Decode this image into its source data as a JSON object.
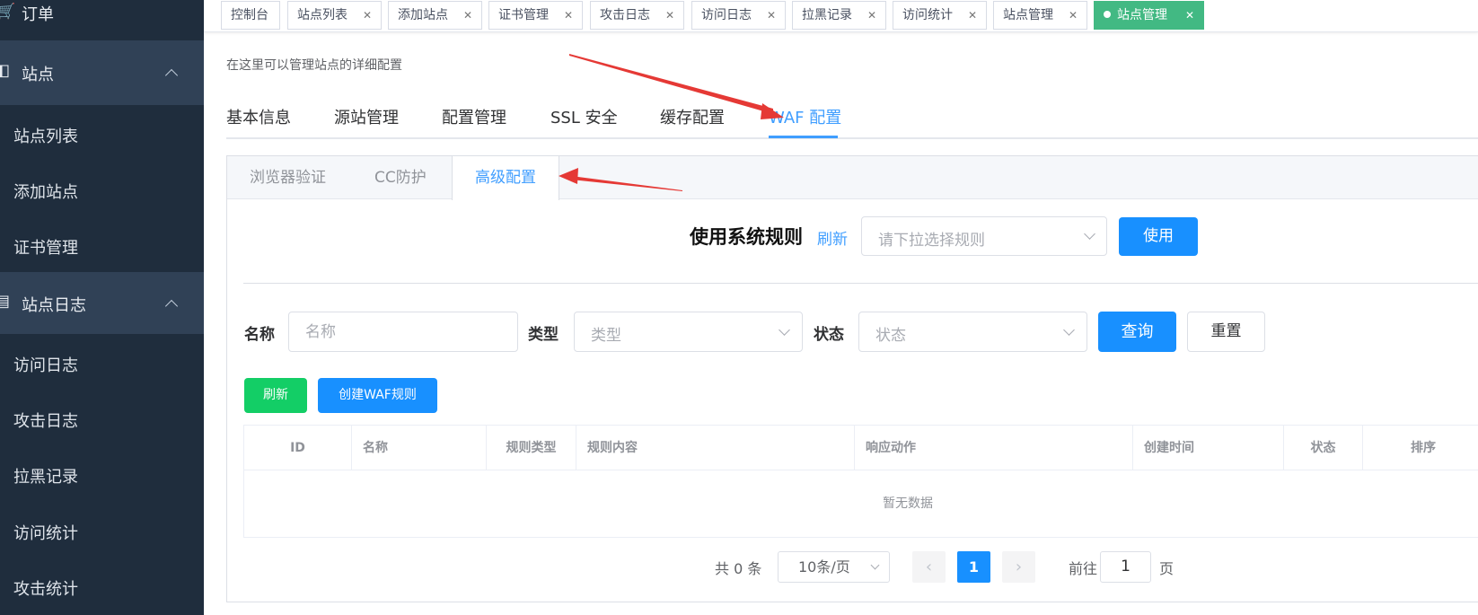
{
  "sidebar": {
    "order_label": "订单",
    "groups": [
      {
        "label": "站点",
        "icon": "site-icon"
      },
      {
        "label": "站点日志",
        "icon": "log-icon"
      }
    ],
    "site_items": [
      "站点列表",
      "添加站点",
      "证书管理"
    ],
    "log_items": [
      "访问日志",
      "攻击日志",
      "拉黑记录",
      "访问统计",
      "攻击统计"
    ]
  },
  "tags": [
    {
      "label": "控制台"
    },
    {
      "label": "站点列表"
    },
    {
      "label": "添加站点"
    },
    {
      "label": "证书管理"
    },
    {
      "label": "攻击日志"
    },
    {
      "label": "访问日志"
    },
    {
      "label": "拉黑记录"
    },
    {
      "label": "访问统计"
    },
    {
      "label": "站点管理"
    },
    {
      "label": "站点管理",
      "active": true
    }
  ],
  "description": "在这里可以管理站点的详细配置",
  "main_tabs": [
    "基本信息",
    "源站管理",
    "配置管理",
    "SSL 安全",
    "缓存配置",
    "WAF 配置"
  ],
  "active_main_tab": "WAF 配置",
  "sub_tabs": [
    "浏览器验证",
    "CC防护",
    "高级配置"
  ],
  "active_sub_tab": "高级配置",
  "system_rules": {
    "title": "使用系统规则",
    "refresh_link": "刷新",
    "select_placeholder": "请下拉选择规则",
    "use_button": "使用"
  },
  "filters": {
    "name_label": "名称",
    "name_placeholder": "名称",
    "type_label": "类型",
    "type_placeholder": "类型",
    "status_label": "状态",
    "status_placeholder": "状态",
    "query_button": "查询",
    "reset_button": "重置"
  },
  "actions": {
    "refresh_button": "刷新",
    "create_button": "创建WAF规则"
  },
  "table": {
    "columns": [
      "ID",
      "名称",
      "规则类型",
      "规则内容",
      "响应动作",
      "创建时间",
      "状态",
      "排序"
    ],
    "empty_text": "暂无数据"
  },
  "pagination": {
    "total": "共 0 条",
    "page_size": "10条/页",
    "prev": "‹",
    "next": "›",
    "current_page": "1",
    "goto_label": "前往",
    "goto_value": "1",
    "page_suffix": "页"
  },
  "colors": {
    "sidebar_bg": "#1f2d3d",
    "sidebar_group_bg": "#304156",
    "primary": "#1890ff",
    "success": "#13ce66",
    "active_tag": "#42b983",
    "annotation_arrow": "#e53935"
  }
}
